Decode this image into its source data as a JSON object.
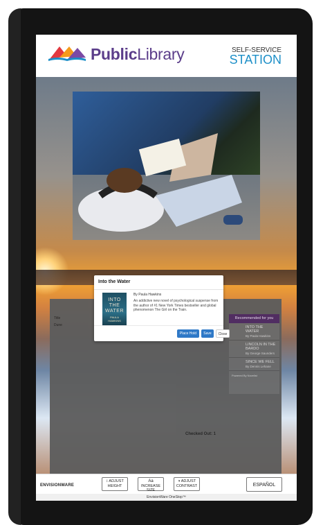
{
  "header": {
    "logo_bold": "Public",
    "logo_rest": "Library",
    "station_top": "SELF-SERVICE",
    "station_big": "STATION"
  },
  "table": {
    "col_title": "Title",
    "row_value": "Dune",
    "checked_out": "Checked Out: 1"
  },
  "recommendations": {
    "heading": "Recommended for you",
    "items": [
      {
        "title": "INTO THE WATER",
        "author": "By Paula Hawkins"
      },
      {
        "title": "LINCOLN IN THE BARDO",
        "author": "By George Saunders"
      },
      {
        "title": "SINCE WE FELL",
        "author": "By Dennis Lehane"
      }
    ],
    "powered_by": "Powered By Novelist"
  },
  "modal": {
    "title": "Into the Water",
    "cover_title": "INTO THE WATER",
    "cover_author": "PAULA HAWKINS",
    "author": "By Paula Hawkins",
    "description": "An addictive new novel of psychological suspense from the author of #1 New York Times bestseller and global phenomenon The Girl on the Train.",
    "buttons": {
      "place_hold": "Place Hold",
      "save": "Save",
      "close": "Close"
    }
  },
  "footer": {
    "brand": "ENVISIONWARE",
    "adjust_height": "ADJUST HEIGHT",
    "increase_size": "INCREASE SIZE",
    "increase_icon": "Aa",
    "adjust_contrast": "ADJUST CONTRAST",
    "espanol": "ESPAÑOL",
    "onestop": "EnvisionWare OneStop™"
  },
  "colors": {
    "brand_purple": "#5b3d8a",
    "accent_blue": "#1d8fc8",
    "button_blue": "#2f79c7",
    "rec_header": "#4d2a63"
  }
}
